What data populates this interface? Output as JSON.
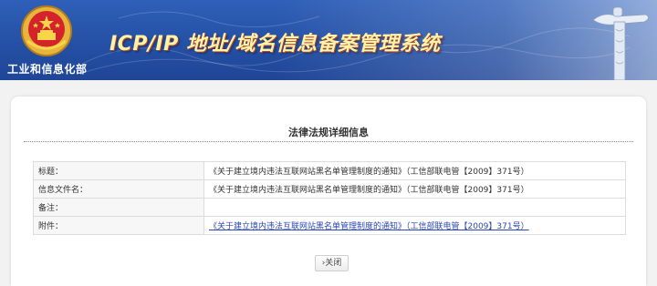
{
  "header": {
    "ministry_name": "工业和信息化部",
    "system_title": "ICP/IP 地址/域名信息备案管理系统",
    "emblem_icon": "national-emblem-icon",
    "monument_icon": "huabiao-column-icon",
    "banner_color": "#2653a8",
    "title_color": "#fff3a8"
  },
  "detail": {
    "title": "法律法规详细信息",
    "rows": [
      {
        "label": "标题：",
        "value": "《关于建立境内违法互联网站黑名单管理制度的通知》（工信部联电管【2009】371号）"
      },
      {
        "label": "信息文件名：",
        "value": "《关于建立境内违法互联网站黑名单管理制度的通知》（工信部联电管【2009】371号）"
      },
      {
        "label": "备注：",
        "value": ""
      },
      {
        "label": "附件：",
        "value": "《关于建立境内违法互联网站黑名单管理制度的通知》（工信部联电管【2009】371号）"
      }
    ],
    "close_label": "›关闭",
    "link_color": "#2a46b5"
  }
}
